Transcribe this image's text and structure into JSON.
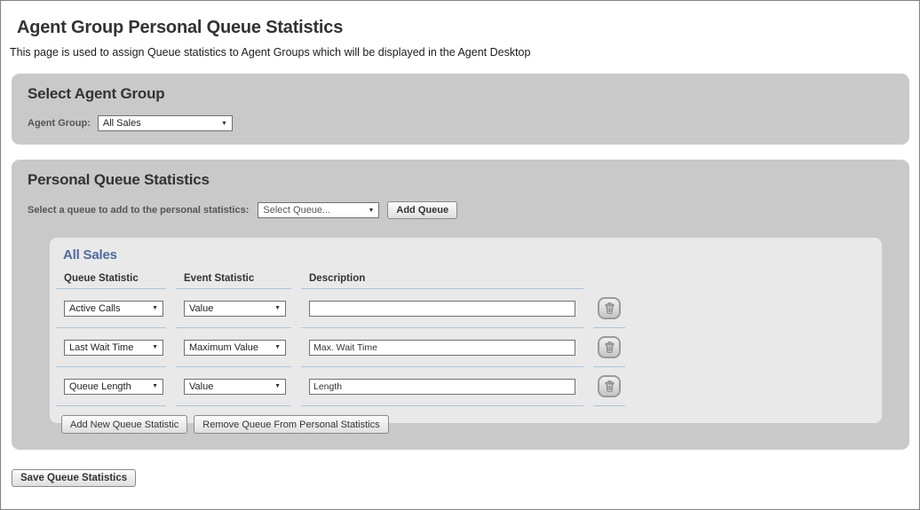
{
  "page": {
    "title": "Agent Group Personal Queue Statistics",
    "subtitle": "This page is used to assign Queue statistics to Agent Groups which will be displayed in the Agent Desktop"
  },
  "icons": {
    "dropdown_arrow": "▼",
    "trash": "trash-icon"
  },
  "select_agent_group": {
    "heading": "Select Agent Group",
    "label": "Agent Group:",
    "selected": "All Sales"
  },
  "personal_queue_statistics": {
    "heading": "Personal Queue Statistics",
    "queue_select_label": "Select a queue to add to the personal statistics:",
    "queue_select_value": "Select Queue...",
    "add_queue_button": "Add Queue",
    "group_panel": {
      "title": "All Sales",
      "columns": [
        "Queue Statistic",
        "Event Statistic",
        "Description"
      ],
      "rows": [
        {
          "queue_statistic": "Active Calls",
          "event_statistic": "Value",
          "description": ""
        },
        {
          "queue_statistic": "Last Wait Time",
          "event_statistic": "Maximum Value",
          "description": "Max. Wait Time"
        },
        {
          "queue_statistic": "Queue Length",
          "event_statistic": "Value",
          "description": "Length"
        }
      ],
      "add_new_button": "Add New Queue Statistic",
      "remove_button": "Remove Queue From Personal Statistics"
    }
  },
  "save_button": "Save Queue Statistics",
  "colors": {
    "panel_gray": "#c9c9c9",
    "inner_panel_gray": "#e9e9e9",
    "group_title_blue": "#4f6b9e",
    "cell_border_blue": "#a9c6dd",
    "heading_text": "#333333"
  }
}
